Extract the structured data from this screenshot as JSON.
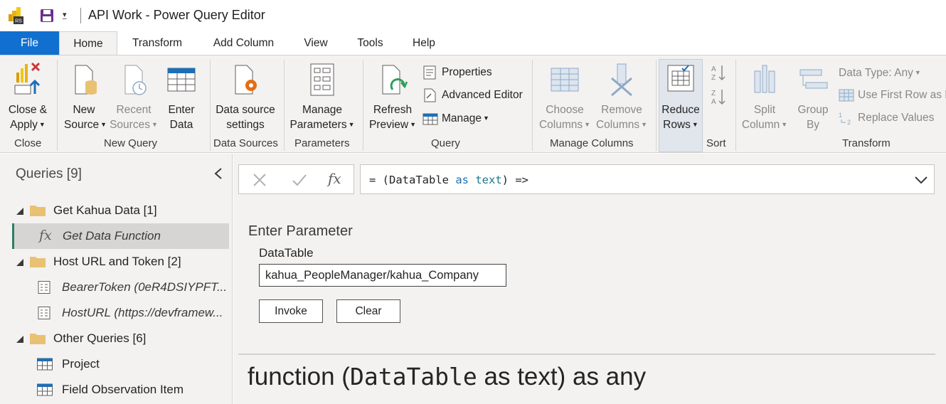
{
  "window": {
    "title": "API Work - Power Query Editor",
    "app_icon_text": "RS"
  },
  "tabs": [
    "File",
    "Home",
    "Transform",
    "Add Column",
    "View",
    "Tools",
    "Help"
  ],
  "ribbon": {
    "close_apply": {
      "line1": "Close &",
      "line2": "Apply"
    },
    "new_source": {
      "line1": "New",
      "line2": "Source"
    },
    "recent_sources": {
      "line1": "Recent",
      "line2": "Sources"
    },
    "enter_data": {
      "line1": "Enter",
      "line2": "Data"
    },
    "data_source_settings": {
      "line1": "Data source",
      "line2": "settings"
    },
    "manage_parameters": {
      "line1": "Manage",
      "line2": "Parameters"
    },
    "refresh_preview": {
      "line1": "Refresh",
      "line2": "Preview"
    },
    "properties": "Properties",
    "advanced_editor": "Advanced Editor",
    "manage": "Manage",
    "choose_columns": {
      "line1": "Choose",
      "line2": "Columns"
    },
    "remove_columns": {
      "line1": "Remove",
      "line2": "Columns"
    },
    "reduce_rows": {
      "line1": "Reduce",
      "line2": "Rows"
    },
    "split_column": {
      "line1": "Split",
      "line2": "Column"
    },
    "group_by": {
      "line1": "Group",
      "line2": "By"
    },
    "data_type": "Data Type: Any",
    "use_first_row": "Use First Row as H",
    "replace_values": "Replace Values",
    "groups": {
      "close": "Close",
      "new_query": "New Query",
      "data_sources": "Data Sources",
      "parameters": "Parameters",
      "query": "Query",
      "manage_columns": "Manage Columns",
      "sort": "Sort",
      "transform": "Transform"
    }
  },
  "queries": {
    "header": "Queries [9]",
    "items": [
      {
        "label": "Get Kahua Data [1]"
      },
      {
        "label": "Get Data Function"
      },
      {
        "label": "Host URL and Token [2]"
      },
      {
        "label": "BearerToken (0eR4DSIYPFT..."
      },
      {
        "label": "HostURL (https://devframew..."
      },
      {
        "label": "Other Queries [6]"
      },
      {
        "label": "Project"
      },
      {
        "label": "Field Observation Item"
      }
    ]
  },
  "formula": {
    "prefix": "= (DataTable ",
    "as": "as",
    "type": "text",
    "suffix": ") =>"
  },
  "parameter": {
    "heading": "Enter Parameter",
    "field_label": "DataTable",
    "field_value": "kahua_PeopleManager/kahua_Company",
    "invoke": "Invoke",
    "clear": "Clear"
  },
  "signature": {
    "pre": "function (",
    "param": "DataTable",
    "post": " as text) as any"
  },
  "colors": {
    "file_tab": "#1170cf",
    "selected_marker": "#2f7d67",
    "folder": "#e8c173"
  }
}
